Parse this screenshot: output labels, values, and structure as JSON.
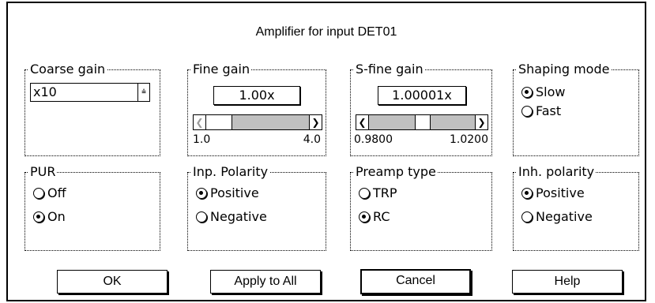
{
  "dialog": {
    "title": "Amplifier for input DET01"
  },
  "coarse_gain": {
    "title": "Coarse gain",
    "value": "x10"
  },
  "fine_gain": {
    "title": "Fine gain",
    "value": "1.00x",
    "min": "1.0",
    "max": "4.0",
    "position_fraction": 0
  },
  "sfine_gain": {
    "title": "S-fine gain",
    "value": "1.00001x",
    "min": "0.9800",
    "max": "1.0200",
    "position_fraction": 0.5
  },
  "shaping_mode": {
    "title": "Shaping mode",
    "options": [
      {
        "label": "Slow",
        "checked": true
      },
      {
        "label": "Fast",
        "checked": false
      }
    ]
  },
  "pur": {
    "title": "PUR",
    "options": [
      {
        "label": "Off",
        "checked": false
      },
      {
        "label": "On",
        "checked": true
      }
    ]
  },
  "inp_polarity": {
    "title": "Inp. Polarity",
    "options": [
      {
        "label": "Positive",
        "checked": true
      },
      {
        "label": "Negative",
        "checked": false
      }
    ]
  },
  "preamp_type": {
    "title": "Preamp type",
    "options": [
      {
        "label": "TRP",
        "checked": false
      },
      {
        "label": "RC",
        "checked": true
      }
    ]
  },
  "inh_polarity": {
    "title": "Inh. polarity",
    "options": [
      {
        "label": "Positive",
        "checked": true
      },
      {
        "label": "Negative",
        "checked": false
      }
    ]
  },
  "buttons": {
    "ok": "OK",
    "apply_all": "Apply to All",
    "cancel": "Cancel",
    "help": "Help"
  }
}
